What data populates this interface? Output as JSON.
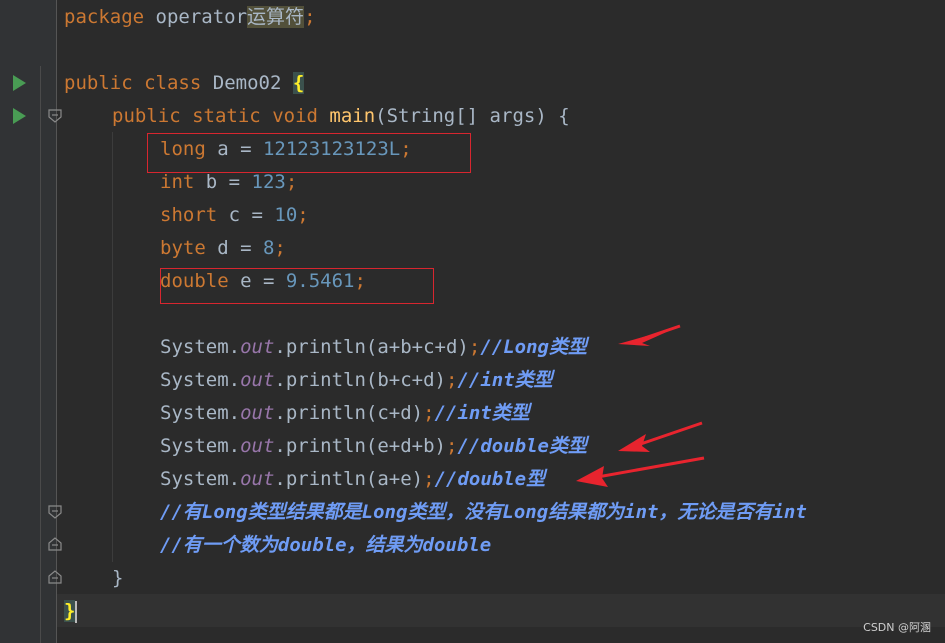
{
  "code": {
    "package_kw": "package",
    "package_name": "operator",
    "package_cn": "运算符",
    "semicolon": ";",
    "public": "public",
    "class": "class",
    "class_name": "Demo02",
    "open_brace": "{",
    "static": "static",
    "void": "void",
    "main": "main",
    "main_params": "(String[] args) {",
    "long": "long",
    "a_decl": " a = ",
    "a_val": "12123123123L",
    "int": "int",
    "b_decl": " b = ",
    "b_val": "123",
    "short": "short",
    "c_decl": " c = ",
    "c_val": "10",
    "byte": "byte",
    "d_decl": " d = ",
    "d_val": "8",
    "double": "double",
    "e_decl": " e = ",
    "e_val": "9.5461",
    "system": "System.",
    "out": "out",
    "println": ".println",
    "args1": "(a+b+c+d)",
    "cmt1": "//Long类型",
    "args2": "(b+c+d)",
    "cmt2": "//int类型",
    "args3": "(c+d)",
    "cmt3": "//int类型",
    "args4": "(e+d+b)",
    "cmt4": "//double类型",
    "args5": "(a+e)",
    "cmt5": "//double型",
    "cmt6": "//有Long类型结果都是Long类型，没有Long结果都为int，无论是否有int",
    "cmt7": "//有一个数为double，结果为double",
    "close_brace": "}"
  },
  "watermark": "CSDN @阿溷",
  "icons": [
    "run-icon",
    "fold-icon",
    "arrow-annotation"
  ],
  "colors": {
    "keyword": "#cc7832",
    "number": "#6897bb",
    "method": "#ffc66d",
    "field": "#9876aa",
    "comment": "#6f9cf5",
    "annotation": "#e8242e"
  }
}
